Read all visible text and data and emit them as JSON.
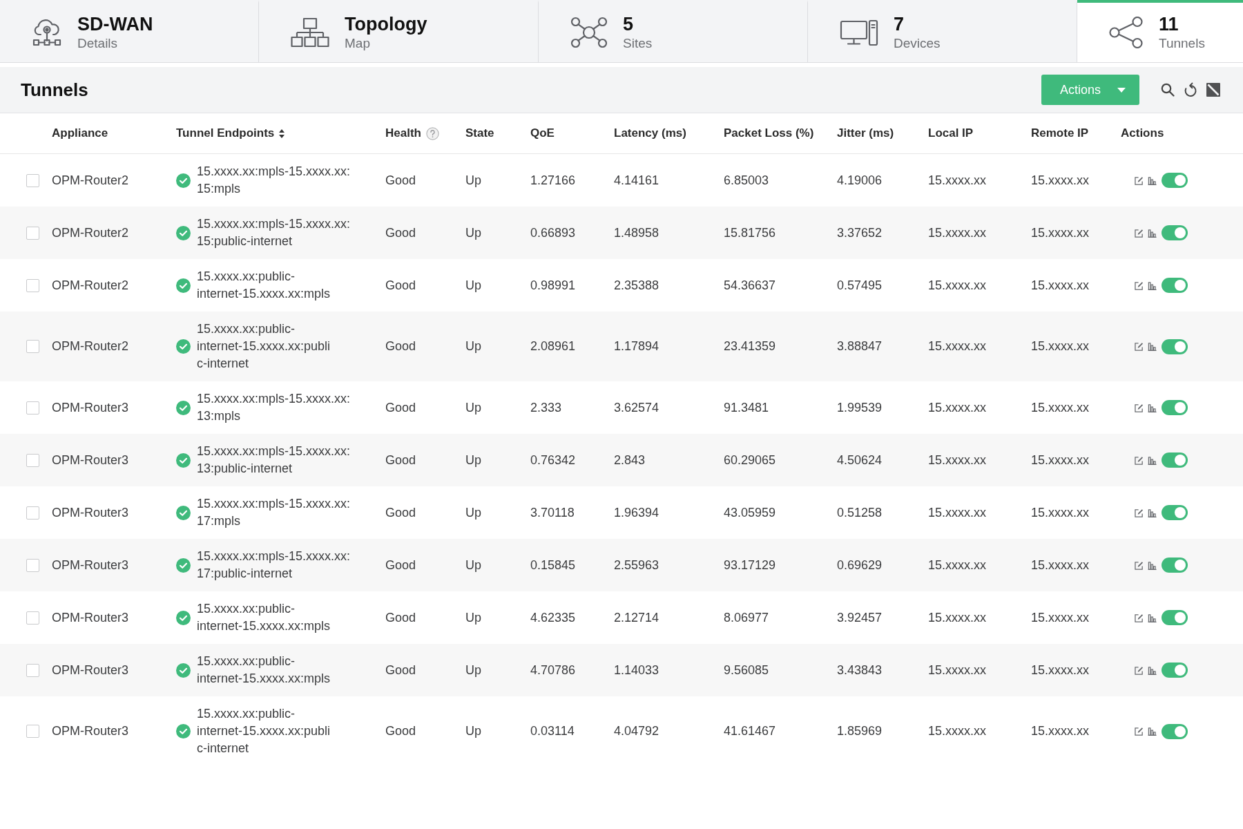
{
  "nav_tabs": [
    {
      "title": "SD-WAN",
      "subtitle": "Details",
      "selected": false
    },
    {
      "title": "Topology",
      "subtitle": "Map",
      "selected": false
    },
    {
      "title": "5",
      "subtitle": "Sites",
      "selected": false
    },
    {
      "title": "7",
      "subtitle": "Devices",
      "selected": false
    },
    {
      "title": "11",
      "subtitle": "Tunnels",
      "selected": true
    }
  ],
  "section": {
    "title": "Tunnels",
    "actions_button": "Actions"
  },
  "table": {
    "columns": [
      {
        "label": "Appliance",
        "sortable": false,
        "help": false
      },
      {
        "label": "Tunnel Endpoints",
        "sortable": true,
        "help": false
      },
      {
        "label": "Health",
        "sortable": false,
        "help": true
      },
      {
        "label": "State",
        "sortable": false,
        "help": false
      },
      {
        "label": "QoE",
        "sortable": false,
        "help": false
      },
      {
        "label": "Latency (ms)",
        "sortable": false,
        "help": false
      },
      {
        "label": "Packet Loss (%)",
        "sortable": false,
        "help": false
      },
      {
        "label": "Jitter (ms)",
        "sortable": false,
        "help": false
      },
      {
        "label": "Local IP",
        "sortable": false,
        "help": false
      },
      {
        "label": "Remote IP",
        "sortable": false,
        "help": false
      },
      {
        "label": "Actions",
        "sortable": false,
        "help": false
      }
    ],
    "rows": [
      {
        "checked": false,
        "appliance": "OPM-Router2",
        "endpoint": "15.xxxx.xx:mpls-15.xxxx.xx:\n15:mpls",
        "health": "Good",
        "state": "Up",
        "qoe": "1.27166",
        "latency": "4.14161",
        "packet_loss": "6.85003",
        "jitter": "4.19006",
        "local_ip": "15.xxxx.xx",
        "remote_ip": "15.xxxx.xx",
        "on": true
      },
      {
        "checked": false,
        "appliance": "OPM-Router2",
        "endpoint": "15.xxxx.xx:mpls-15.xxxx.xx:\n15:public-internet",
        "health": "Good",
        "state": "Up",
        "qoe": "0.66893",
        "latency": "1.48958",
        "packet_loss": "15.81756",
        "jitter": "3.37652",
        "local_ip": "15.xxxx.xx",
        "remote_ip": "15.xxxx.xx",
        "on": true
      },
      {
        "checked": false,
        "appliance": "OPM-Router2",
        "endpoint": "15.xxxx.xx:public-\ninternet-15.xxxx.xx:mpls",
        "health": "Good",
        "state": "Up",
        "qoe": "0.98991",
        "latency": "2.35388",
        "packet_loss": "54.36637",
        "jitter": "0.57495",
        "local_ip": "15.xxxx.xx",
        "remote_ip": "15.xxxx.xx",
        "on": true
      },
      {
        "checked": false,
        "appliance": "OPM-Router2",
        "endpoint": "15.xxxx.xx:public-\ninternet-15.xxxx.xx:publi\nc-internet",
        "health": "Good",
        "state": "Up",
        "qoe": "2.08961",
        "latency": "1.17894",
        "packet_loss": "23.41359",
        "jitter": "3.88847",
        "local_ip": "15.xxxx.xx",
        "remote_ip": "15.xxxx.xx",
        "on": true
      },
      {
        "checked": false,
        "appliance": "OPM-Router3",
        "endpoint": "15.xxxx.xx:mpls-15.xxxx.xx:\n13:mpls",
        "health": "Good",
        "state": "Up",
        "qoe": "2.333",
        "latency": "3.62574",
        "packet_loss": "91.3481",
        "jitter": "1.99539",
        "local_ip": "15.xxxx.xx",
        "remote_ip": "15.xxxx.xx",
        "on": true
      },
      {
        "checked": false,
        "appliance": "OPM-Router3",
        "endpoint": "15.xxxx.xx:mpls-15.xxxx.xx:\n13:public-internet",
        "health": "Good",
        "state": "Up",
        "qoe": "0.76342",
        "latency": "2.843",
        "packet_loss": "60.29065",
        "jitter": "4.50624",
        "local_ip": "15.xxxx.xx",
        "remote_ip": "15.xxxx.xx",
        "on": true
      },
      {
        "checked": false,
        "appliance": "OPM-Router3",
        "endpoint": "15.xxxx.xx:mpls-15.xxxx.xx:\n17:mpls",
        "health": "Good",
        "state": "Up",
        "qoe": "3.70118",
        "latency": "1.96394",
        "packet_loss": "43.05959",
        "jitter": "0.51258",
        "local_ip": "15.xxxx.xx",
        "remote_ip": "15.xxxx.xx",
        "on": true
      },
      {
        "checked": false,
        "appliance": "OPM-Router3",
        "endpoint": "15.xxxx.xx:mpls-15.xxxx.xx:\n17:public-internet",
        "health": "Good",
        "state": "Up",
        "qoe": "0.15845",
        "latency": "2.55963",
        "packet_loss": "93.17129",
        "jitter": "0.69629",
        "local_ip": "15.xxxx.xx",
        "remote_ip": "15.xxxx.xx",
        "on": true
      },
      {
        "checked": false,
        "appliance": "OPM-Router3",
        "endpoint": "15.xxxx.xx:public-\ninternet-15.xxxx.xx:mpls",
        "health": "Good",
        "state": "Up",
        "qoe": "4.62335",
        "latency": "2.12714",
        "packet_loss": "8.06977",
        "jitter": "3.92457",
        "local_ip": "15.xxxx.xx",
        "remote_ip": "15.xxxx.xx",
        "on": true
      },
      {
        "checked": false,
        "appliance": "OPM-Router3",
        "endpoint": "15.xxxx.xx:public-\ninternet-15.xxxx.xx:mpls",
        "health": "Good",
        "state": "Up",
        "qoe": "4.70786",
        "latency": "1.14033",
        "packet_loss": "9.56085",
        "jitter": "3.43843",
        "local_ip": "15.xxxx.xx",
        "remote_ip": "15.xxxx.xx",
        "on": true
      },
      {
        "checked": false,
        "appliance": "OPM-Router3",
        "endpoint": "15.xxxx.xx:public-\ninternet-15.xxxx.xx:publi\nc-internet",
        "health": "Good",
        "state": "Up",
        "qoe": "0.03114",
        "latency": "4.04792",
        "packet_loss": "41.61467",
        "jitter": "1.85969",
        "local_ip": "15.xxxx.xx",
        "remote_ip": "15.xxxx.xx",
        "on": true
      }
    ]
  }
}
